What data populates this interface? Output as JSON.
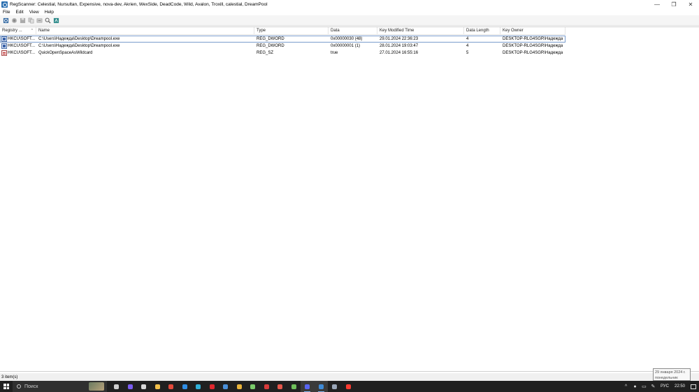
{
  "window": {
    "title": "RegScanner:   Celestial, Nursultan, Expensive, nova-dev, Akrien, WexSide, DeadCode, Wild, Avalon, Troxill, calestial, DreamPool",
    "minimize": "—",
    "restore": "❐",
    "close": "✕"
  },
  "menu": {
    "file": "File",
    "edit": "Edit",
    "view": "View",
    "help": "Help"
  },
  "toolbar": {
    "buttons": [
      "new-scan-icon",
      "stop-icon",
      "save-icon",
      "copy-icon",
      "export-regedit-icon",
      "find-icon",
      "regedit-icon"
    ]
  },
  "table": {
    "columns": [
      "Registry ...",
      "Name",
      "Type",
      "Data",
      "Key Modified Time",
      "Data Length",
      "Key Owner"
    ],
    "sort_indicator": "^",
    "rows": [
      {
        "icon": "dword",
        "registry": "HKCU\\SOFT...",
        "name": "C:\\Users\\Надежда\\Desktop\\Dreampool.exe",
        "type": "REG_DWORD",
        "data": "0x00000030 (48)",
        "modified": "29.01.2024 22:36:23",
        "length": "4",
        "owner": "DESKTOP-RLG4SGR\\Надежда"
      },
      {
        "icon": "dword",
        "registry": "HKCU\\SOFT...",
        "name": "C:\\Users\\Надежда\\Desktop\\Dreampool.exe",
        "type": "REG_DWORD",
        "data": "0x00000001 (1)",
        "modified": "28.01.2024 19:03:47",
        "length": "4",
        "owner": "DESKTOP-RLG4SGR\\Надежда"
      },
      {
        "icon": "sz",
        "registry": "HKCU\\SOFT...",
        "name": "QuickOpenSpaceAsWildcard",
        "type": "REG_SZ",
        "data": "true",
        "modified": "27.01.2024 16:55:16",
        "length": "5",
        "owner": "DESKTOP-RLG4SGR\\Надежда"
      }
    ]
  },
  "status": {
    "items": "3 item(s)"
  },
  "tooltip": {
    "date": "29 января 2024 г.",
    "weekday": "понедельник"
  },
  "taskbar": {
    "search_placeholder": "Поиск",
    "apps": [
      {
        "name": "task-view-icon",
        "color": "#cfcfcf"
      },
      {
        "name": "app-purple-icon",
        "color": "#7a5cf0"
      },
      {
        "name": "app-cat-icon",
        "color": "#d8d8d8"
      },
      {
        "name": "file-explorer-icon",
        "color": "#f2c04a"
      },
      {
        "name": "app-red-icon",
        "color": "#e24a3b"
      },
      {
        "name": "app-blue-icon",
        "color": "#2f8de4"
      },
      {
        "name": "edge-icon",
        "color": "#2fb0d8"
      },
      {
        "name": "opera-icon",
        "color": "#e0282e"
      },
      {
        "name": "app-monitor-icon",
        "color": "#4a8fd8"
      },
      {
        "name": "chrome-icon",
        "color": "#e9b339"
      },
      {
        "name": "app-recycle-icon",
        "color": "#7acb6a"
      },
      {
        "name": "app-mail-icon",
        "color": "#d83a3a"
      },
      {
        "name": "app-gamepad-icon",
        "color": "#e5574b"
      },
      {
        "name": "app-cube-icon",
        "color": "#6fbf5a"
      },
      {
        "name": "discord-icon",
        "color": "#5865f2"
      },
      {
        "name": "regscanner-taskbar-icon",
        "color": "#3f8ad6"
      },
      {
        "name": "app-terminal-icon",
        "color": "#9aa6b8"
      },
      {
        "name": "yandex-icon",
        "color": "#ff3b30"
      }
    ],
    "active_apps": [
      "discord-icon",
      "regscanner-taskbar-icon"
    ],
    "lang": "РУС",
    "time": "22:50"
  }
}
